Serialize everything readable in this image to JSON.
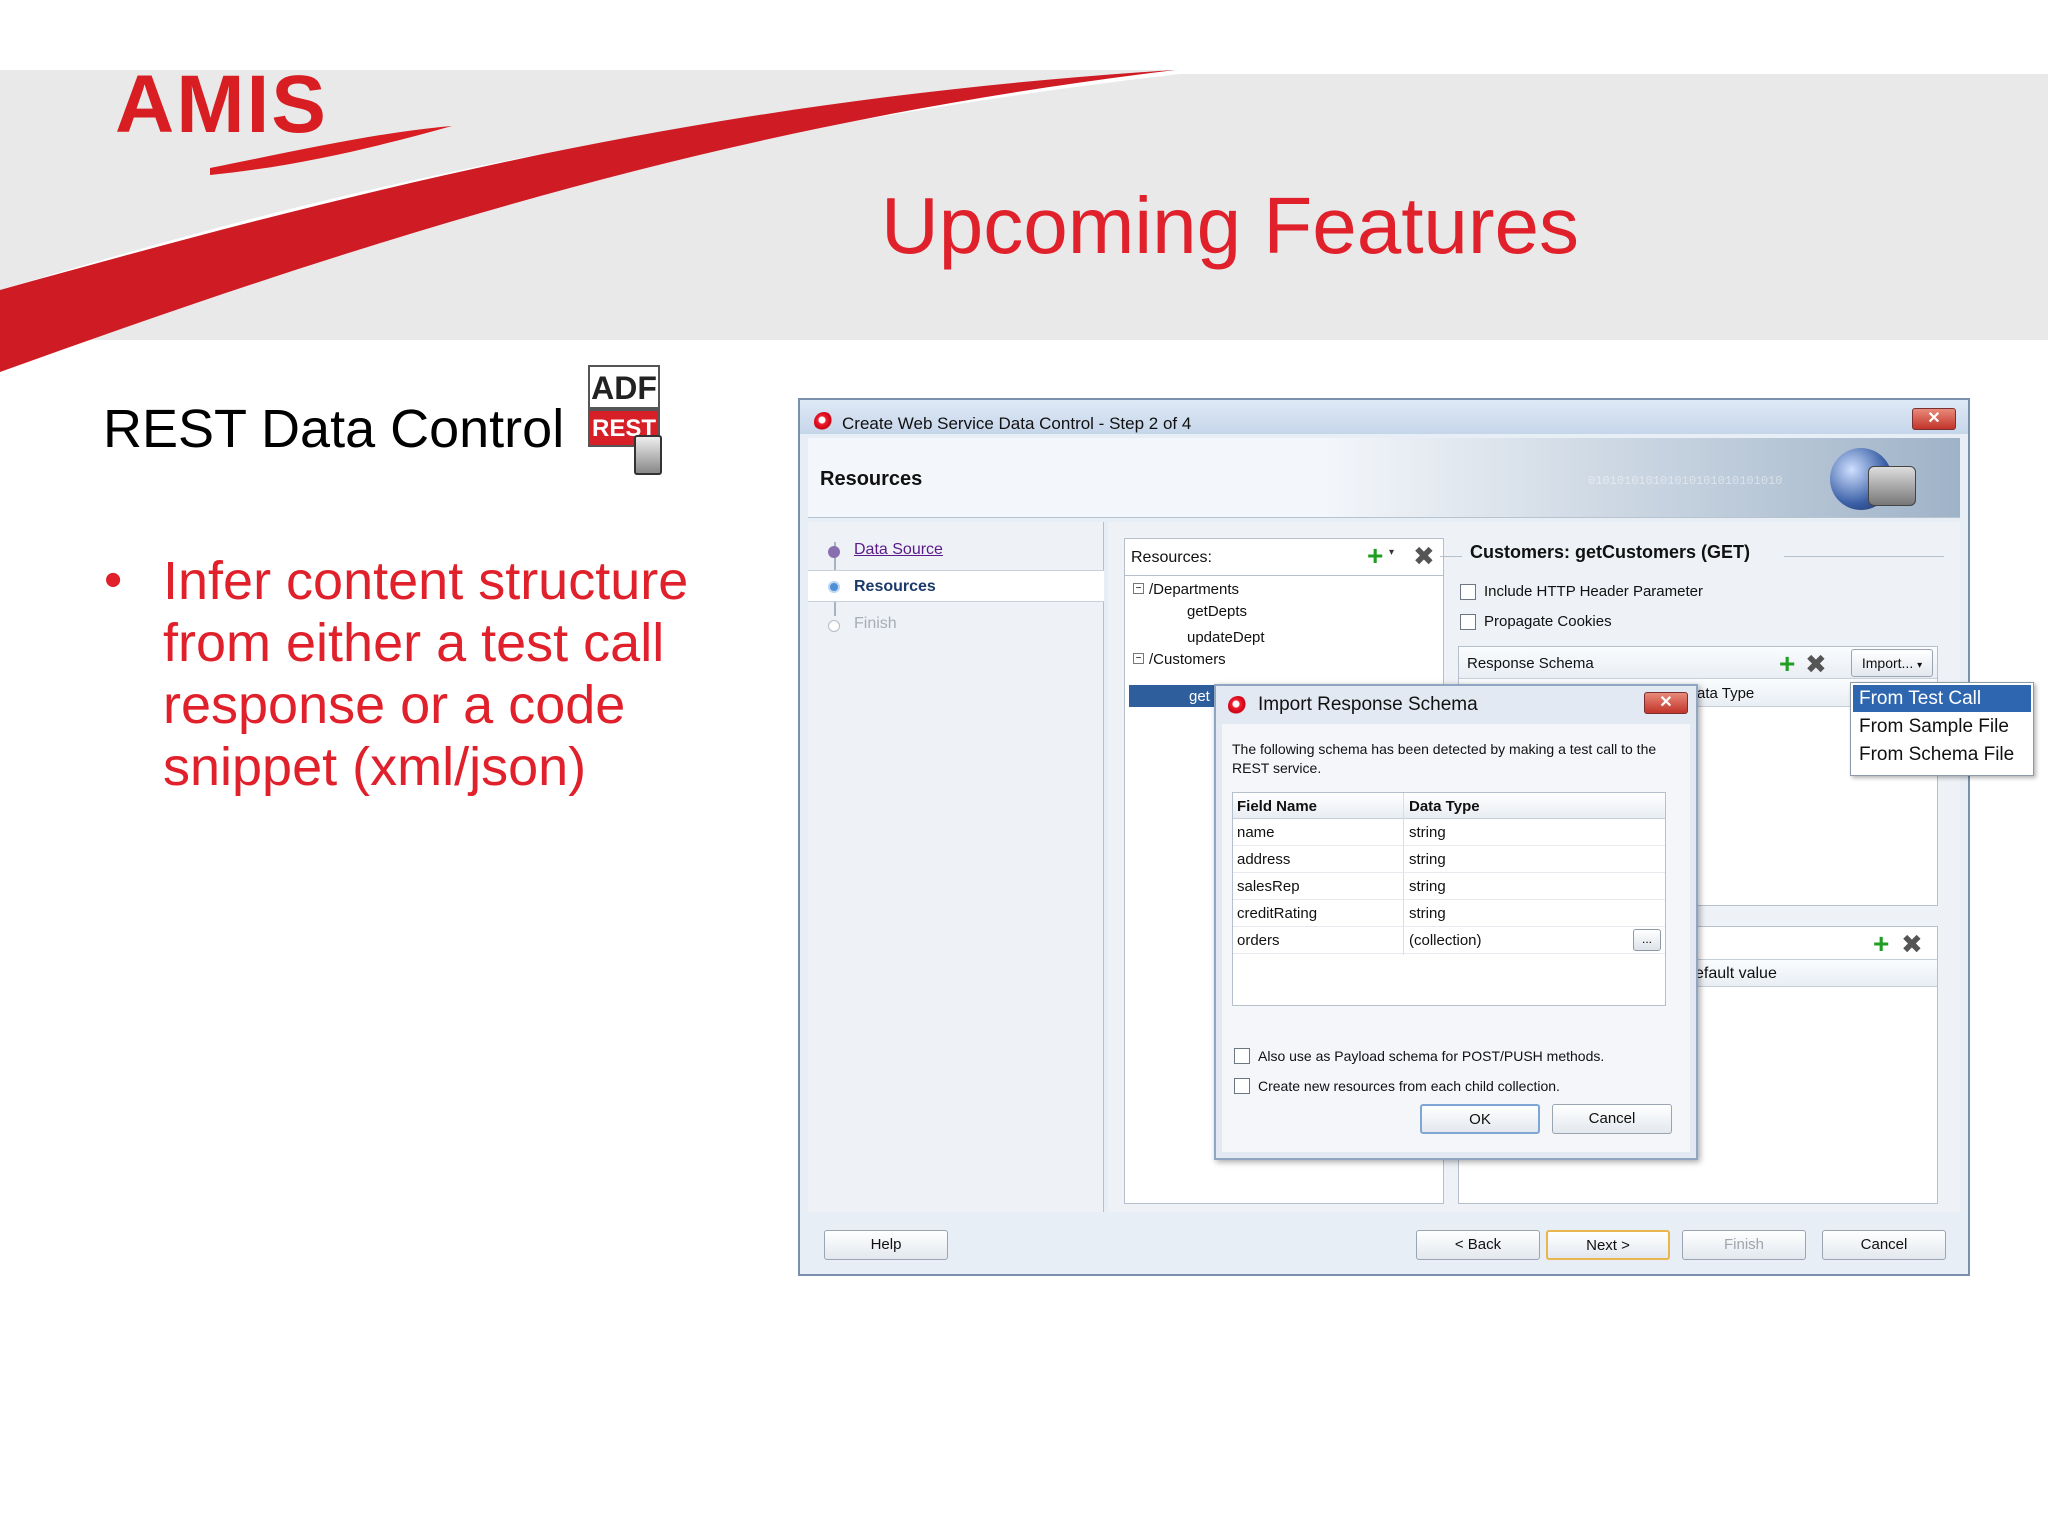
{
  "slide": {
    "logo": "AMIS",
    "title": "Upcoming Features",
    "subtitle": "REST Data Control",
    "icon_top": "ADF",
    "icon_bottom": "REST",
    "bullet": "Infer content structure from either a test call response or a code snippet (xml/json)"
  },
  "window": {
    "title": "Create Web Service Data Control - Step 2 of 4",
    "header": "Resources",
    "close_label": "✕",
    "header_bits": "010101010101010101010101010",
    "nav": [
      {
        "label": "Data Source",
        "state": "link"
      },
      {
        "label": "Resources",
        "state": "active"
      },
      {
        "label": "Finish",
        "state": "disabled"
      }
    ],
    "resources_label": "Resources:",
    "tree": {
      "departments": "/Departments",
      "getDepts": "getDepts",
      "updateDept": "updateDept",
      "customers": "/Customers",
      "getCustomers": "get"
    },
    "detail_title": "Customers: getCustomers (GET)",
    "include_header": "Include HTTP Header Parameter",
    "propagate_cookies": "Propagate Cookies",
    "response_schema": "Response Schema",
    "import_label": "Import...",
    "data_type_partial": "ata Type",
    "default_value_partial": "efault value",
    "import_menu": [
      "From Test Call",
      "From Sample File",
      "From Schema File"
    ],
    "buttons": {
      "help": "Help",
      "back": "< Back",
      "next": "Next >",
      "finish": "Finish",
      "cancel": "Cancel"
    }
  },
  "modal": {
    "title": "Import Response Schema",
    "description": "The following schema has been detected by making a test call to the REST service.",
    "columns": [
      "Field Name",
      "Data Type"
    ],
    "rows": [
      {
        "name": "name",
        "type": "string"
      },
      {
        "name": "address",
        "type": "string"
      },
      {
        "name": "salesRep",
        "type": "string"
      },
      {
        "name": "creditRating",
        "type": "string"
      },
      {
        "name": "orders",
        "type": "(collection)"
      }
    ],
    "ellipsis": "...",
    "payload_option": "Also use as Payload schema for POST/PUSH methods.",
    "child_option": "Create new resources from each child collection.",
    "ok": "OK",
    "cancel": "Cancel",
    "close_label": "✕"
  },
  "colors": {
    "accent_red": "#e0202a",
    "selection_blue": "#2f66b0"
  }
}
